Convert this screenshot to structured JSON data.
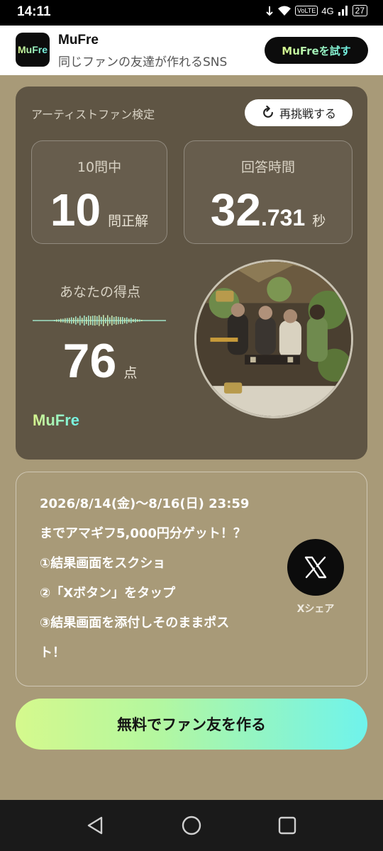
{
  "status_bar": {
    "time": "14:11",
    "network": "4G",
    "volte": "VoLTE",
    "battery": "27"
  },
  "app_banner": {
    "name": "MuFre",
    "tagline": "同じファンの友達が作れるSNS",
    "cta": "MuFreを試す",
    "logo_text": "MuFre"
  },
  "result": {
    "quiz_label": "アーティストファン検定",
    "retry_label": "再挑戦する",
    "questions_caption": "10問中",
    "correct_count": "10",
    "correct_unit": "問正解",
    "time_caption": "回答時間",
    "time_int": "32",
    "time_dec": ".731",
    "time_unit": "秒",
    "score_caption": "あなたの得点",
    "score": "76",
    "score_unit": "点",
    "logo_text": "MuFre"
  },
  "campaign": {
    "lines": [
      "2026/8/14(金)〜8/16(日) 23:59",
      "までアマギフ5,000円分ゲット！？",
      "①結果画面をスクショ",
      "②「Xボタン」をタップ",
      "③結果画面を添付しそのままポス",
      "ト！"
    ],
    "x_share_label": "Xシェア"
  },
  "cta": {
    "label": "無料でファン友を作る"
  },
  "colors": {
    "page_bg": "#a89a78",
    "card_bg": "#5f5544",
    "accent_start": "#d5f98d",
    "accent_end": "#6ff3ec"
  },
  "icons": [
    "wifi-icon",
    "signal-icon",
    "battery-icon",
    "refresh-icon",
    "x-logo-icon",
    "nav-back-icon",
    "nav-home-icon",
    "nav-recents-icon"
  ]
}
